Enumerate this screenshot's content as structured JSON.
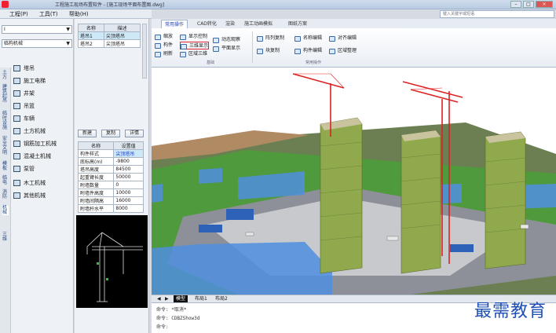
{
  "titlebar": {
    "title": "工程施工现场布置软件 - [施工现场平面布置图.dwg]"
  },
  "menubar": {
    "items": [
      "工程(P)",
      "工具(T)",
      "帮助(H)"
    ]
  },
  "search": {
    "placeholder": "键入关键字或短语"
  },
  "left": {
    "combo1": "I",
    "combo2": "临构机械",
    "vtabs": [
      "土方",
      "建筑起吊",
      "临时设施",
      "安全文明",
      "模板",
      "临电",
      "消防",
      "机械",
      "三维"
    ],
    "tools": [
      "塔吊",
      "施工电梯",
      "井架",
      "吊篮",
      "车辆",
      "土方机械",
      "钢筋加工机械",
      "混凝土机械",
      "泵管",
      "木工机械",
      "其他机械"
    ]
  },
  "layers": {
    "headers": [
      "名称",
      "描述"
    ],
    "rows": [
      [
        "塔吊1",
        "尖顶塔吊"
      ],
      [
        "塔吊2",
        "尖顶塔吊"
      ]
    ]
  },
  "prop_buttons": [
    "新建",
    "复制",
    "详情"
  ],
  "props": {
    "headers": [
      "名称",
      "设置值"
    ],
    "rows": [
      [
        "构件样式",
        "尖顶塔吊"
      ],
      [
        "底标高(m)",
        "-9800"
      ],
      [
        "塔吊高度",
        "84500"
      ],
      [
        "起重臂长度",
        "50000"
      ],
      [
        "附墙数量",
        "0"
      ],
      [
        "附墙件高度",
        "10000"
      ],
      [
        "附墙间隔高",
        "16000"
      ],
      [
        "附墙杆水平",
        "8000"
      ]
    ]
  },
  "ribbon": {
    "tabs": [
      "常用操作",
      "CAD转化",
      "渲染",
      "施工动画模拟",
      "图纸方案"
    ],
    "buttons": [
      "缩放",
      "显示控制",
      "动态观察",
      "阵列复制",
      "名称编辑",
      "对齐编辑",
      "构件",
      "三维显示",
      "平面显示",
      "块复制",
      "构件编辑",
      "区域整理",
      "刷新",
      "区域三维"
    ],
    "groups": [
      "基础",
      "常用操作"
    ]
  },
  "view_tabs": [
    "模型",
    "布局1",
    "布局2"
  ],
  "cmdline": [
    "命令: *取消*",
    "命令: CDBZShow3d",
    "命令:"
  ],
  "watermark": "最需教育"
}
